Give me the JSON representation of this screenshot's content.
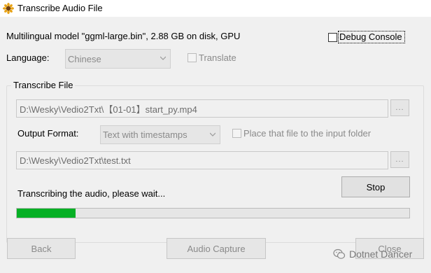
{
  "window": {
    "title": "Transcribe Audio File",
    "app_icon": "sunflower-icon"
  },
  "model_info": "Multilingual model \"ggml-large.bin\", 2.88 GB on disk, GPU",
  "debug_console": {
    "label": "Debug Console",
    "checked": false
  },
  "language": {
    "label": "Language:",
    "value": "Chinese"
  },
  "translate": {
    "label": "Translate",
    "checked": false
  },
  "transcribe_file": {
    "group_title": "Transcribe File",
    "input_path": "D:\\Wesky\\Vedio2Txt\\【01-01】start_py.mp4",
    "browse_input_label": "...",
    "output_format_label": "Output Format:",
    "output_format_value": "Text with timestamps",
    "place_to_input_folder": {
      "label": "Place that file to the input folder",
      "checked": false
    },
    "output_path": "D:\\Wesky\\Vedio2Txt\\test.txt",
    "browse_output_label": "...",
    "status_text": "Transcribing the audio, please wait...",
    "stop_label": "Stop",
    "progress_fraction": 0.15
  },
  "footer": {
    "back_label": "Back",
    "audio_capture_label": "Audio Capture",
    "close_label": "Close"
  },
  "watermark": {
    "text": "Dotnet Dancer",
    "icon": "wechat-icon"
  },
  "colors": {
    "progress_fill": "#06b025",
    "window_bg": "#f0f0f0"
  }
}
